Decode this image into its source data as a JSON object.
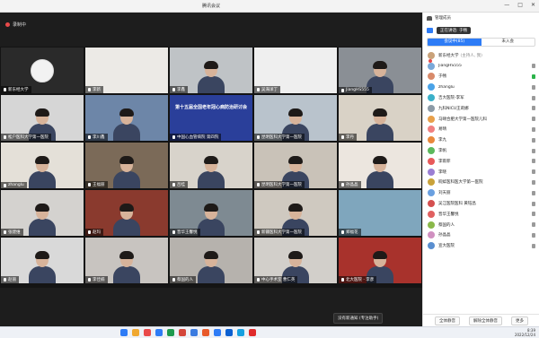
{
  "window": {
    "title": "腾讯会议",
    "controls": [
      "—",
      "□",
      "✕"
    ]
  },
  "meeting": {
    "recording_label": "录制中",
    "tiles": [
      {
        "name": "新东经大学",
        "kind": "avatar",
        "bg": "#2a2a2a"
      },
      {
        "name": "李新",
        "kind": "logo",
        "bg": "#eceae6"
      },
      {
        "name": "李鑫",
        "kind": "person",
        "bg": "#bfc3c6"
      },
      {
        "name": "吴海洋丁",
        "kind": "room",
        "bg": "#efefef"
      },
      {
        "name": "JiangHS555",
        "kind": "person",
        "bg": "#8a8f95"
      },
      {
        "name": "松户医科大学第一医院",
        "kind": "person",
        "bg": "#d6d6d6"
      },
      {
        "name": "李川鑫",
        "kind": "person",
        "bg": "#6d86a8"
      },
      {
        "name": "中国心血管病院 第四院",
        "kind": "slide",
        "bg": "#2a3f9a",
        "slide_title": "第十五届全国老年冠心病防治研讨会"
      },
      {
        "name": "昆明医科大学第一医院",
        "kind": "person",
        "bg": "#b9c3cc"
      },
      {
        "name": "李丹",
        "kind": "person",
        "bg": "#d9d2c6"
      },
      {
        "name": "zhanglu",
        "kind": "person",
        "bg": "#e4e0d8"
      },
      {
        "name": "王福丽",
        "kind": "person",
        "bg": "#7b6a58"
      },
      {
        "name": "吕桂",
        "kind": "person",
        "bg": "#d8d3cb"
      },
      {
        "name": "昆明医科大学第一医院",
        "kind": "person",
        "bg": "#c9c2b8"
      },
      {
        "name": "孙晶晶",
        "kind": "person",
        "bg": "#ece6df"
      },
      {
        "name": "张建维",
        "kind": "person",
        "bg": "#d4d2cf"
      },
      {
        "name": "赵玛",
        "kind": "person",
        "bg": "#8a3a2e"
      },
      {
        "name": "晋华王馨悦",
        "kind": "person",
        "bg": "#7e8a92"
      },
      {
        "name": "新疆医科大学第一医院",
        "kind": "person",
        "bg": "#cfc9c0"
      },
      {
        "name": "郑福花",
        "kind": "water",
        "bg": "#7fa6bd"
      },
      {
        "name": "赵丽",
        "kind": "person",
        "bg": "#d9d9d9"
      },
      {
        "name": "李佳楠",
        "kind": "person",
        "bg": "#c8c4c0"
      },
      {
        "name": "蔡国的人",
        "kind": "person",
        "bg": "#b6b2ad"
      },
      {
        "name": "中心手术室 曹仁英",
        "kind": "person",
        "bg": "#d2cfca"
      },
      {
        "name": "北大医院 · 李彦",
        "kind": "person",
        "bg": "#a8322c"
      }
    ],
    "tooltip": "没有新通知 (专注助手)"
  },
  "panel": {
    "title": "管理成员",
    "speaking_label": "正在讲话:",
    "speaking_name": "于畅",
    "tabs": [
      {
        "label": "会议中(85)",
        "active": true
      },
      {
        "label": "未入会",
        "active": false
      }
    ],
    "members": [
      {
        "name": "新东经大学",
        "sub": "(主持人, 我)",
        "color": "#c9a27a",
        "status": "rec"
      },
      {
        "name": "JiangHS555",
        "color": "#7aa8d8",
        "status": "off"
      },
      {
        "name": "于畅",
        "color": "#d88a6a",
        "status": "on"
      },
      {
        "name": "zhanglu",
        "color": "#4aa3e8",
        "status": "off"
      },
      {
        "name": "吉大医院-李军",
        "color": "#3bb0c9",
        "status": "off"
      },
      {
        "name": "九科NICU王莉娜",
        "color": "#8c9aa6",
        "status": "off"
      },
      {
        "name": "马颐合肥大学第一医院儿科",
        "color": "#e8a04a",
        "status": "off"
      },
      {
        "name": "易晴",
        "color": "#f08080",
        "status": "off"
      },
      {
        "name": "李九",
        "color": "#e8883c",
        "status": "off"
      },
      {
        "name": "李帆",
        "color": "#5cb85c",
        "status": "off"
      },
      {
        "name": "李雨菲",
        "color": "#e85a5a",
        "status": "off"
      },
      {
        "name": "李晓",
        "color": "#9b7fd4",
        "status": "off"
      },
      {
        "name": "皖蚌医科医大学第一医院",
        "color": "#c9a23a",
        "status": "off"
      },
      {
        "name": "刘天丽",
        "color": "#6aa0e0",
        "status": "off"
      },
      {
        "name": "吴江医院医科 黄钰昌",
        "color": "#d45050",
        "status": "off"
      },
      {
        "name": "晋华王馨悦",
        "color": "#e06060",
        "status": "off"
      },
      {
        "name": "蔡国的人",
        "color": "#8ab84a",
        "status": "off"
      },
      {
        "name": "孙晶晶",
        "color": "#d090c0",
        "status": "off"
      },
      {
        "name": "宣大医院",
        "color": "#5a8fd0",
        "status": "off"
      }
    ],
    "footer": {
      "mute_all": "全体静音",
      "unmute_all": "解除全体静音",
      "more": "更多"
    }
  },
  "taskbar": {
    "time": "8:39",
    "date": "2022/12/24",
    "icon_colors": [
      "#2e7cf6",
      "#f0a830",
      "#e94a4a",
      "#2e7cf6",
      "#1e9a4e",
      "#d4463a",
      "#3a7be0",
      "#e85a2a",
      "#2e7cf6",
      "#0a5fd1",
      "#16a0e0",
      "#e02b2b"
    ]
  }
}
